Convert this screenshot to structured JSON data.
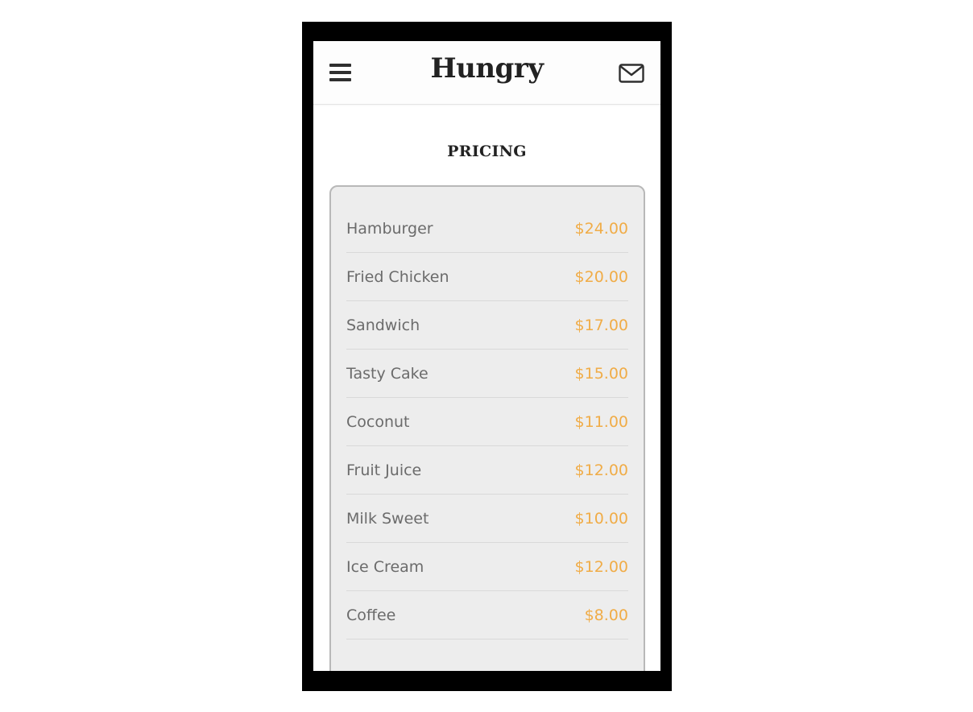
{
  "header": {
    "brand": "Hungry",
    "menu_icon": "hamburger-menu-icon",
    "mail_icon": "envelope-icon"
  },
  "section": {
    "title": "PRICING"
  },
  "pricing": {
    "items": [
      {
        "name": "Hamburger",
        "price": "$24.00"
      },
      {
        "name": "Fried Chicken",
        "price": "$20.00"
      },
      {
        "name": "Sandwich",
        "price": "$17.00"
      },
      {
        "name": "Tasty Cake",
        "price": "$15.00"
      },
      {
        "name": "Coconut",
        "price": "$11.00"
      },
      {
        "name": "Fruit Juice",
        "price": "$12.00"
      },
      {
        "name": "Milk Sweet",
        "price": "$10.00"
      },
      {
        "name": "Ice Cream",
        "price": "$12.00"
      },
      {
        "name": "Coffee",
        "price": "$8.00"
      }
    ]
  },
  "colors": {
    "price_accent": "#f0ac47",
    "item_text": "#6b6b6b",
    "card_background": "#ededed",
    "frame": "#000000"
  }
}
